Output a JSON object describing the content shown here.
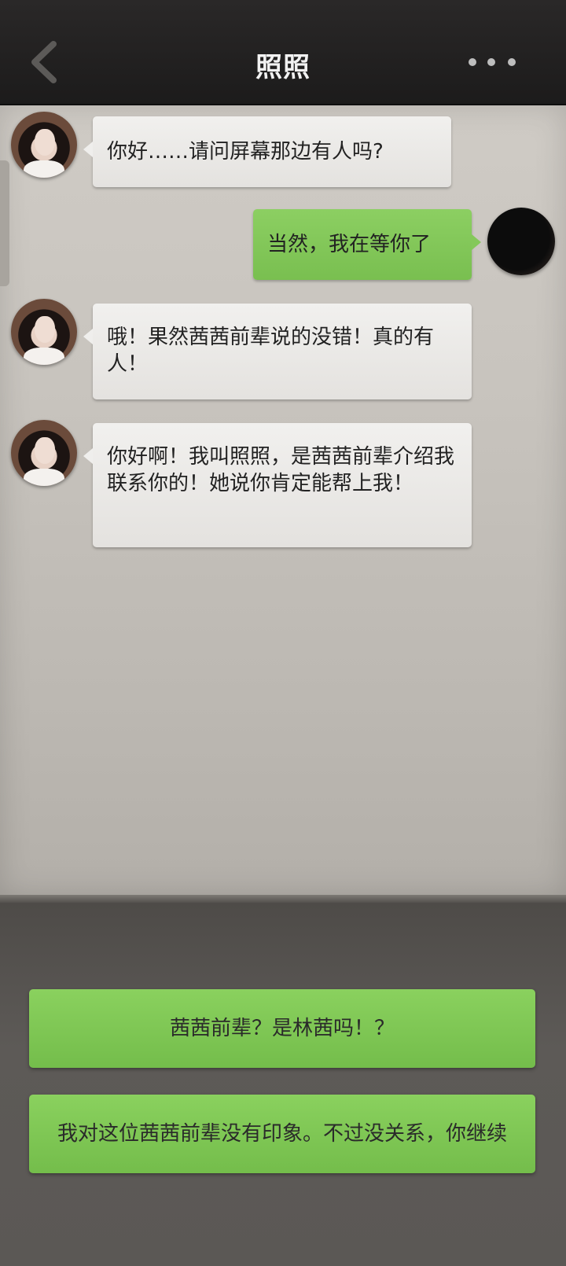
{
  "header": {
    "title": "照照",
    "back_icon": "chevron-left-icon",
    "more_icon": "more-dots-icon"
  },
  "messages": [
    {
      "side": "left",
      "text": "你好……请问屏幕那边有人吗?"
    },
    {
      "side": "right",
      "text": "当然，我在等你了"
    },
    {
      "side": "left",
      "text": "哦！果然茜茜前辈说的没错！真的有人！"
    },
    {
      "side": "left",
      "text": "你好啊！我叫照照，是茜茜前辈介绍我联系你的！她说你肯定能帮上我！"
    }
  ],
  "options": [
    {
      "text": "茜茜前辈？是林茜吗！？"
    },
    {
      "text": "我对这位茜茜前辈没有印象。不过没关系，你继续"
    }
  ],
  "colors": {
    "header_bg": "#1f1e1e",
    "chat_bg": "#c8c4be",
    "bubble_left": "#ecebe8",
    "bubble_right": "#84c85a",
    "option_green": "#80c756"
  }
}
